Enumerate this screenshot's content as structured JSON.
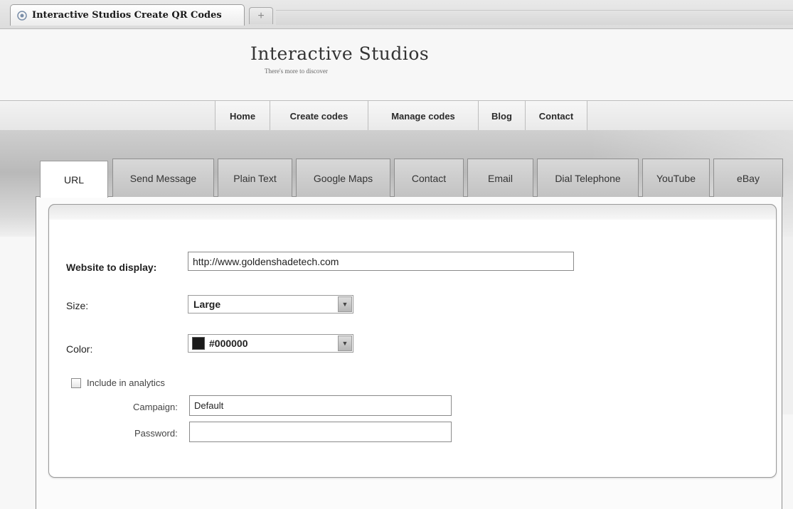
{
  "browser": {
    "tab_title": "Interactive Studios Create QR Codes",
    "new_tab_label": "+"
  },
  "site": {
    "title": "Interactive Studios",
    "tagline": "There's more to discover"
  },
  "nav": {
    "items": [
      "Home",
      "Create codes",
      "Manage codes",
      "Blog",
      "Contact"
    ]
  },
  "code_tabs": {
    "items": [
      "URL",
      "Send Message",
      "Plain Text",
      "Google Maps",
      "Contact",
      "Email",
      "Dial Telephone",
      "YouTube",
      "eBay"
    ],
    "active": "URL"
  },
  "form": {
    "website_label": "Website to display:",
    "website_value": "http://www.goldenshadetech.com",
    "size_label": "Size:",
    "size_value": "Large",
    "color_label": "Color:",
    "color_value": "#000000",
    "color_swatch": "#1a1a1a",
    "analytics_label": "Include in analytics",
    "analytics_checked": false,
    "campaign_label": "Campaign:",
    "campaign_value": "Default",
    "password_label": "Password:",
    "password_value": ""
  }
}
